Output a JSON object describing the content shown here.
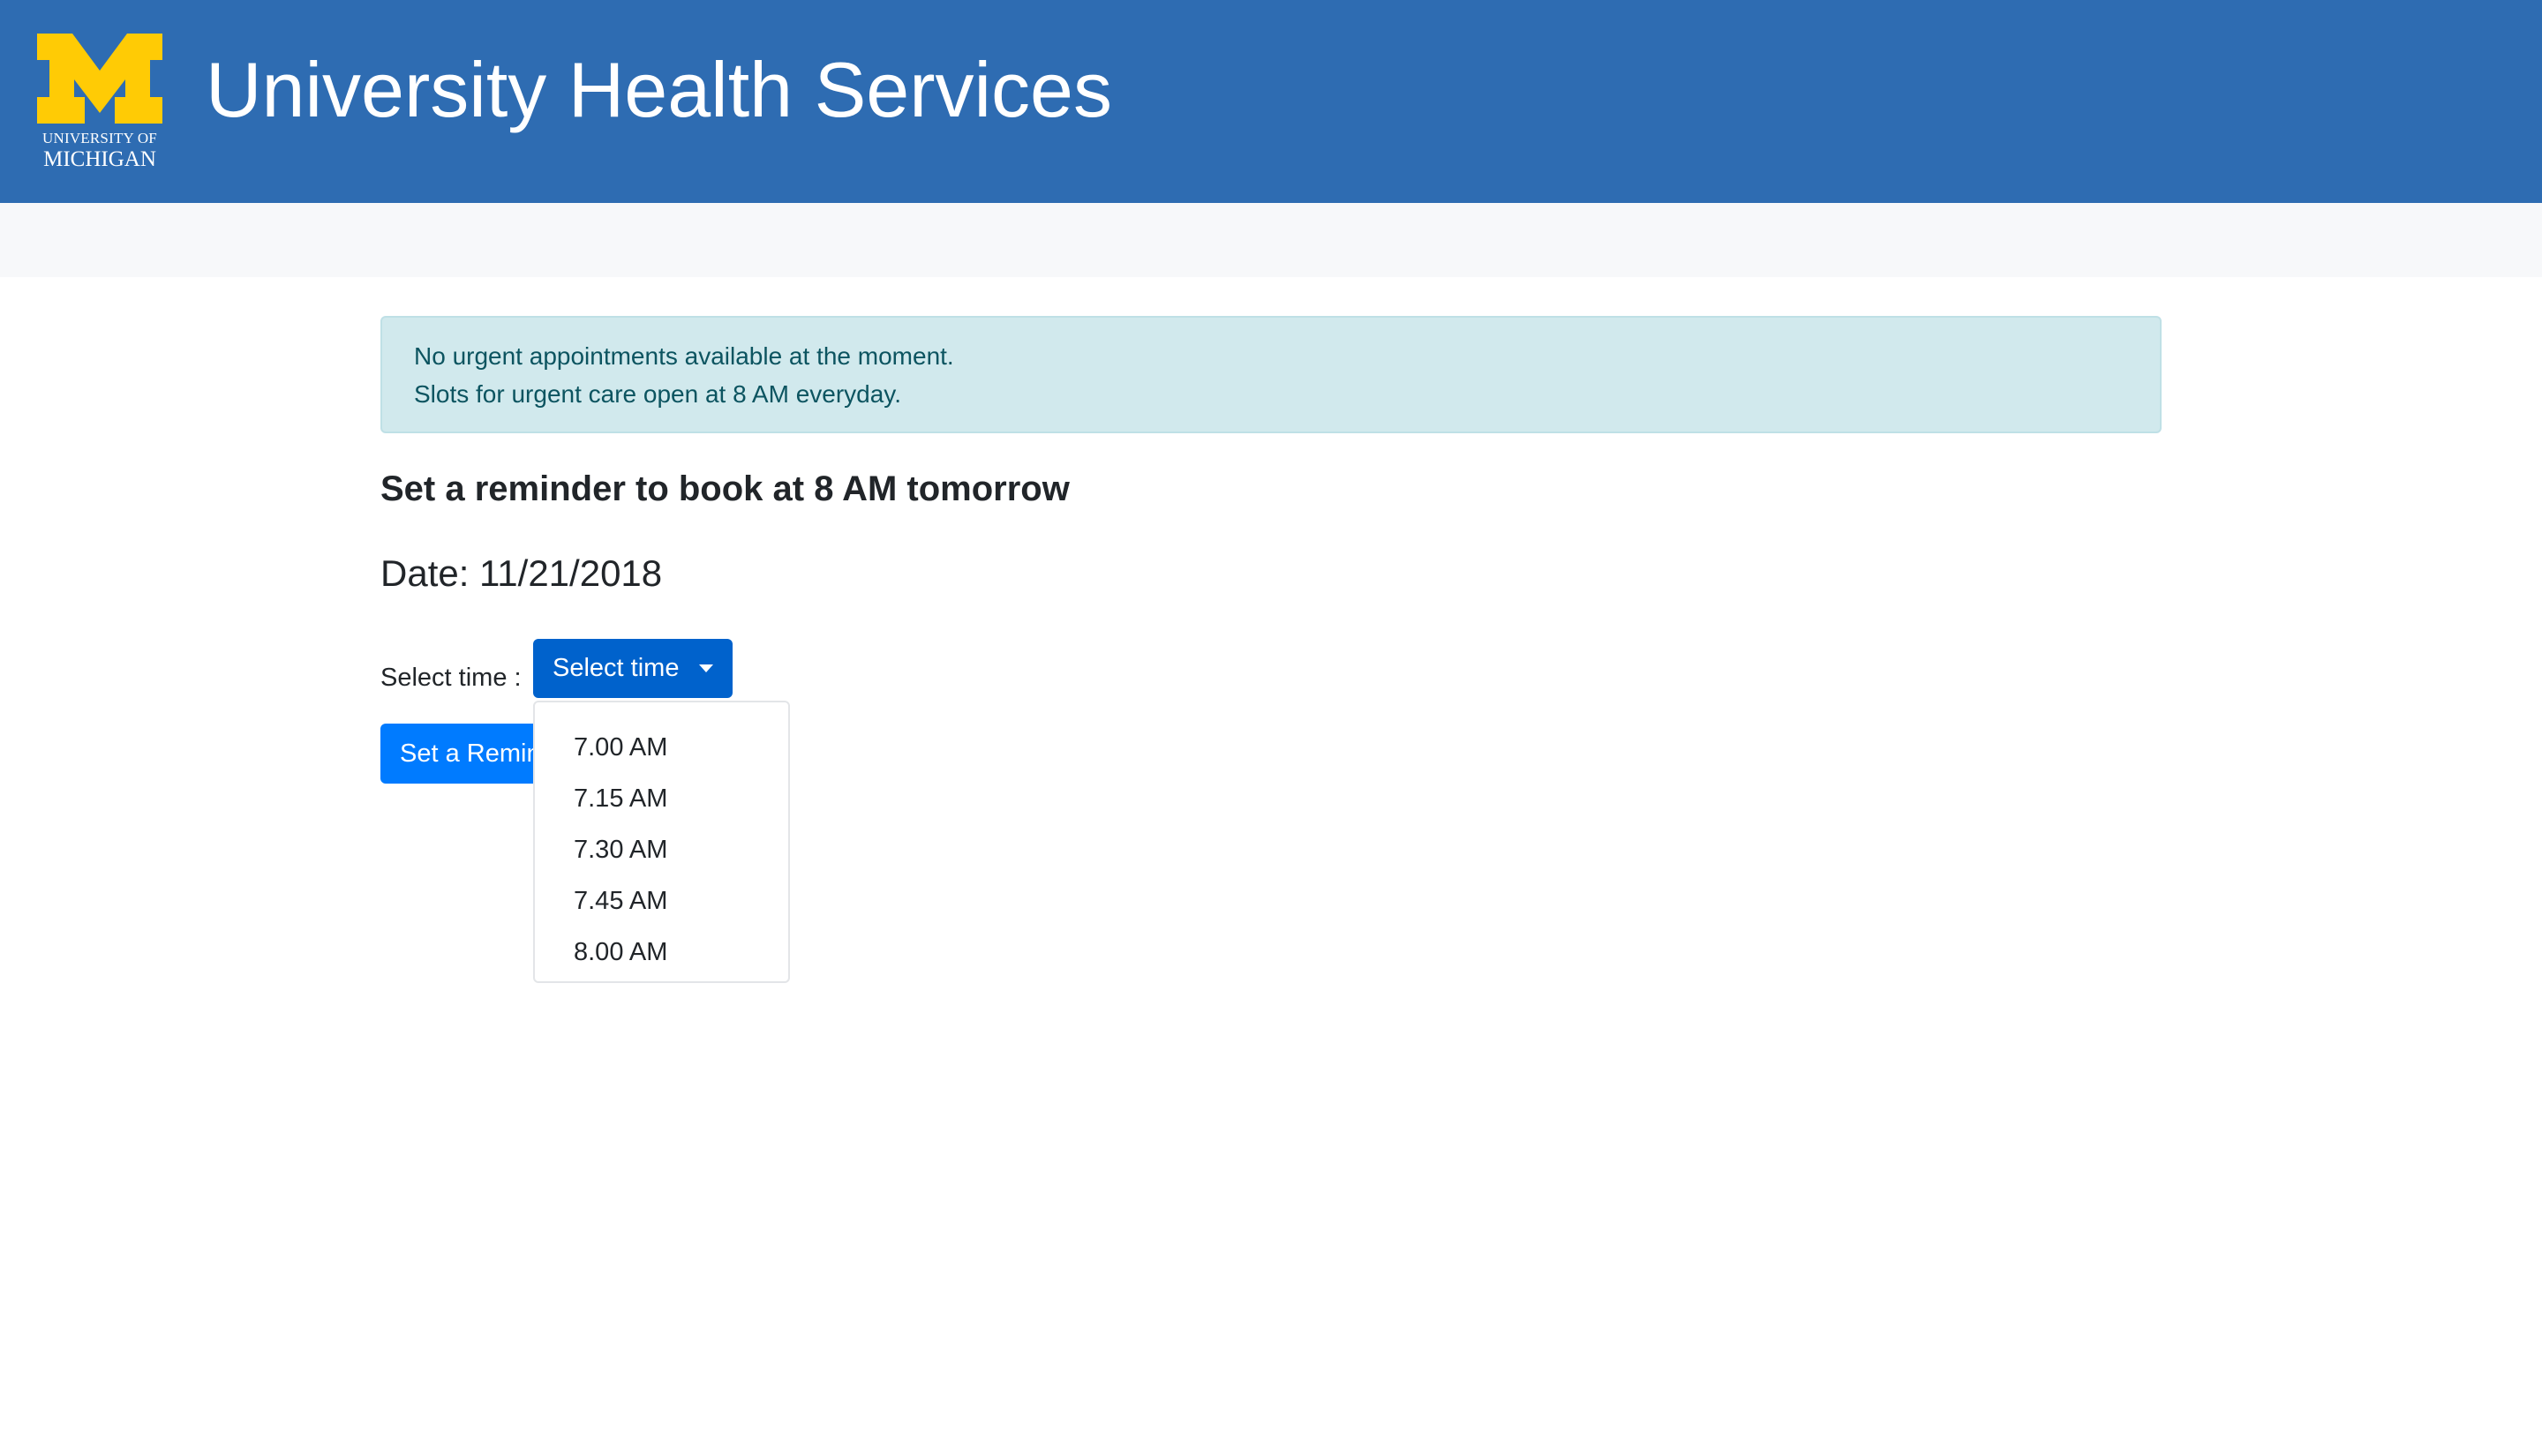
{
  "header": {
    "logo": {
      "line1": "UNIVERSITY OF",
      "line2": "MICHIGAN",
      "brand_color": "#ffcb05",
      "icon": "block-m-logo"
    },
    "title": "University Health Services",
    "background_color": "#2e6cb2"
  },
  "alert": {
    "line1": "No urgent appointments available at the moment.",
    "line2": "Slots for urgent care open at 8 AM everyday."
  },
  "main": {
    "heading": "Set a reminder to book at 8 AM tomorrow",
    "date_text": "Date: 11/21/2018",
    "select_label": "Select time :",
    "select_button_label": "Select time",
    "reminder_button_label": "Set a Reminder"
  },
  "dropdown": {
    "options": [
      "7.00 AM",
      "7.15 AM",
      "7.30 AM",
      "7.45 AM",
      "8.00 AM"
    ]
  },
  "colors": {
    "primary_button": "#007bff",
    "active_button": "#0062cc",
    "alert_bg": "#d1e9ed",
    "alert_text": "#0c5460"
  }
}
